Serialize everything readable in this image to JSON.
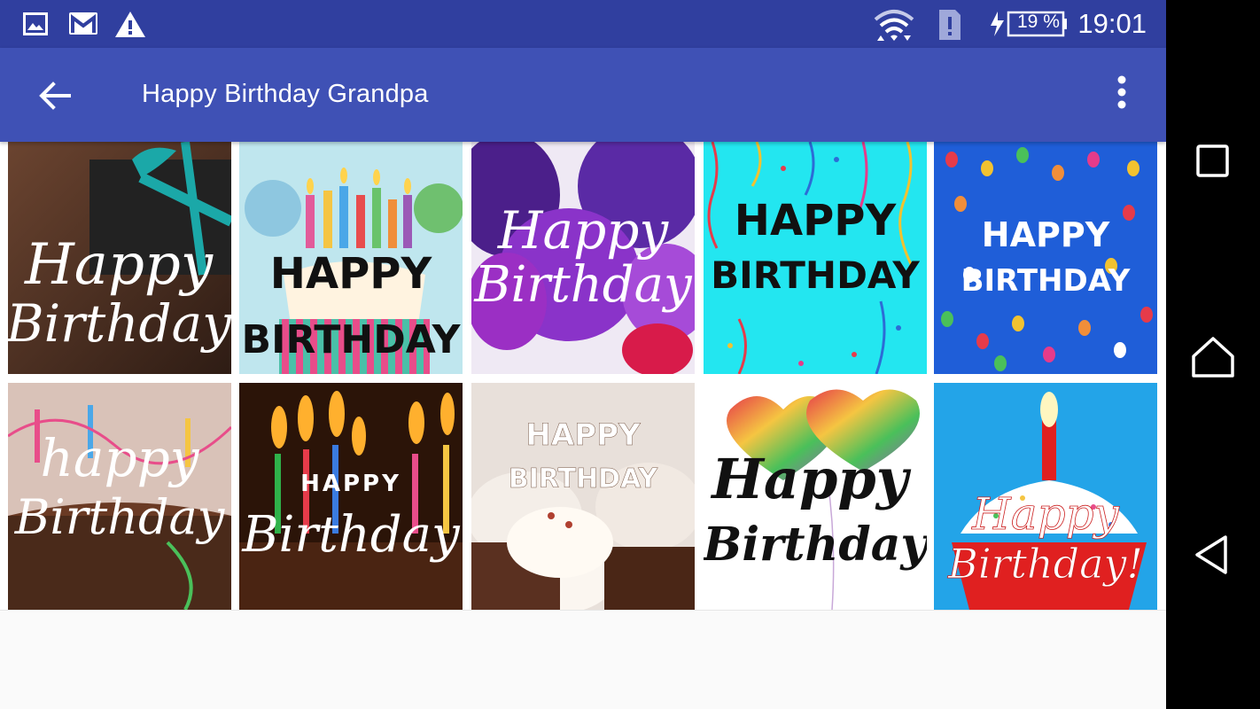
{
  "status_bar": {
    "time": "19:01",
    "battery": "19 %",
    "icons": [
      "image-icon",
      "gmail-icon",
      "warning-icon",
      "wifi-icon",
      "sim-alert-icon",
      "battery-charging-icon"
    ]
  },
  "app_bar": {
    "title": "Happy Birthday Grandpa",
    "back_icon": "arrow-back-icon",
    "menu_icon": "more-vert-icon"
  },
  "grid": {
    "tiles": [
      {
        "line1": "Happy",
        "line2": "Birthday",
        "bg": "#4a2f22",
        "fg": "#ffffff"
      },
      {
        "line1": "HAPPY",
        "line2": "BIRTHDAY",
        "bg": "#bfe6ee",
        "fg": "#111111"
      },
      {
        "line1": "Happy",
        "line2": "Birthday",
        "bg": "#7a2fb2",
        "fg": "#ffffff"
      },
      {
        "line1": "HAPPY",
        "line2": "BIRTHDAY",
        "bg": "#23e6f0",
        "fg": "#111111"
      },
      {
        "line1": "HAPPY",
        "line2": "BIRTHDAY",
        "bg": "#1f5ed8",
        "fg": "#ffffff"
      },
      {
        "line1": "happy",
        "line2": "Birthday",
        "bg": "#a8584a",
        "fg": "#ffffff"
      },
      {
        "line1": "HAPPY",
        "line2": "Birthday",
        "bg": "#2b1408",
        "fg": "#ffffff"
      },
      {
        "line1": "HAPPY",
        "line2": "BIRTHDAY",
        "bg": "#8a5a3e",
        "fg": "#ffffff"
      },
      {
        "line1": "Happy",
        "line2": "Birthday",
        "bg": "#ffffff",
        "fg": "#111111"
      },
      {
        "line1": "Happy",
        "line2": "Birthday!",
        "bg": "#23a4e8",
        "fg": "#ffffff"
      }
    ]
  },
  "nav_bar": {
    "buttons": [
      "recents-button",
      "home-button",
      "back-button"
    ]
  }
}
